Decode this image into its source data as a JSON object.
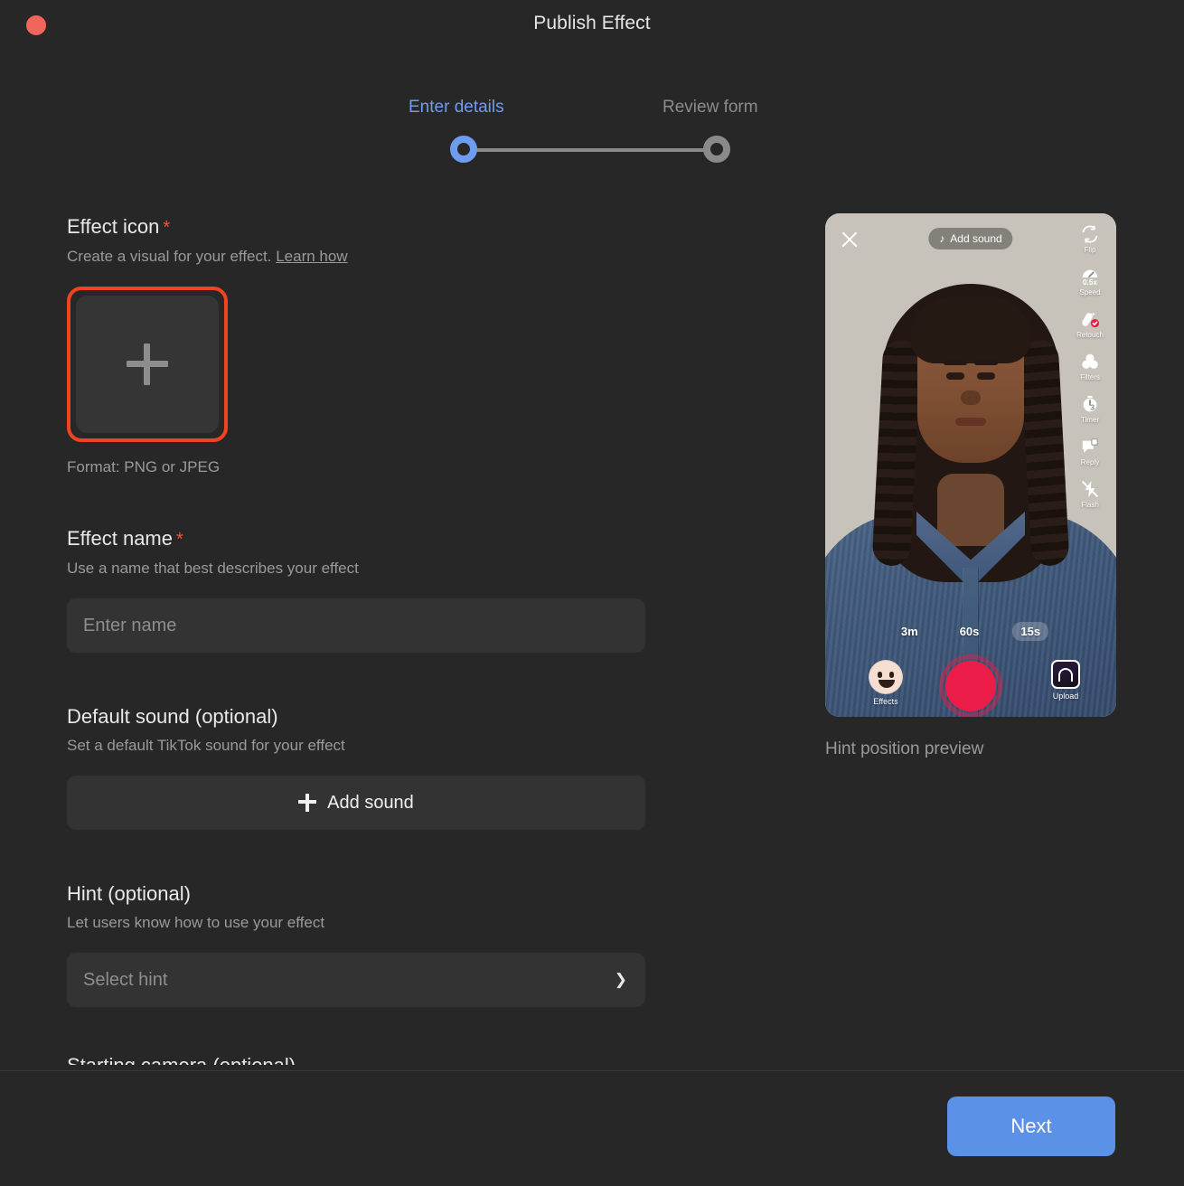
{
  "window": {
    "title": "Publish Effect",
    "close_dot_color": "#f0655c"
  },
  "stepper": {
    "steps": [
      {
        "label": "Enter details",
        "state": "active",
        "color": "#6e9df0"
      },
      {
        "label": "Review form",
        "state": "inactive",
        "color": "#8c8c8c"
      }
    ]
  },
  "form": {
    "effect_icon": {
      "title": "Effect icon",
      "required_mark": "*",
      "subtitle": "Create a visual for your effect.",
      "link_label": "Learn how",
      "upload_glyph": "plus-icon",
      "format_note": "Format: PNG or JPEG",
      "highlight_color": "#f0441f"
    },
    "effect_name": {
      "title": "Effect name",
      "required_mark": "*",
      "subtitle": "Use a name that best describes your effect",
      "placeholder": "Enter name",
      "value": ""
    },
    "default_sound": {
      "title": "Default sound (optional)",
      "subtitle": "Set a default TikTok sound for your effect",
      "button_label": "Add sound"
    },
    "hint": {
      "title": "Hint (optional)",
      "subtitle": "Let users know how to use your effect",
      "placeholder": "Select hint",
      "value": "",
      "chevron": "chevron-down-icon"
    },
    "cut_off_section_title": "Starting camera (optional)"
  },
  "preview": {
    "caption": "Hint position preview",
    "phone": {
      "close_icon": "close-icon",
      "add_sound_label": "Add sound",
      "add_sound_icon": "music-note-icon",
      "rail": [
        {
          "label": "Flip",
          "icon": "flip-camera-icon"
        },
        {
          "label": "Speed",
          "icon": "speed-icon",
          "value": "0.5x"
        },
        {
          "label": "Retouch",
          "icon": "retouch-icon",
          "badge": "check"
        },
        {
          "label": "Filters",
          "icon": "filters-icon"
        },
        {
          "label": "Timer",
          "icon": "timer-icon",
          "value": "3"
        },
        {
          "label": "Reply",
          "icon": "reply-icon"
        },
        {
          "label": "Flash",
          "icon": "flash-off-icon"
        }
      ],
      "durations": [
        {
          "label": "3m",
          "selected": false
        },
        {
          "label": "60s",
          "selected": false
        },
        {
          "label": "15s",
          "selected": true
        }
      ],
      "effects_label": "Effects",
      "upload_label": "Upload",
      "record_button": "record-button",
      "record_color": "#eb1c48"
    }
  },
  "footer": {
    "next_label": "Next",
    "next_color": "#5b92e8"
  }
}
